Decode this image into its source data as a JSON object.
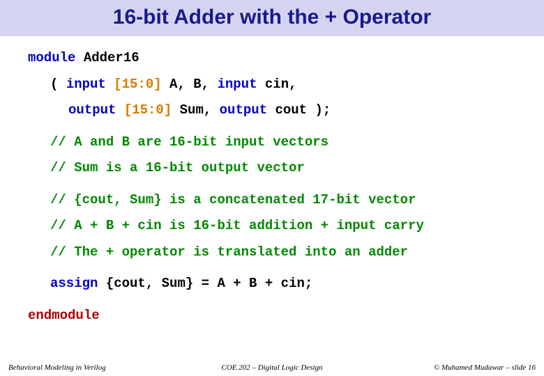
{
  "title": "16-bit Adder with the + Operator",
  "code": {
    "l1_module": "module",
    "l1_name": " Adder16",
    "l2_paren": "( ",
    "l2_input1": "input",
    "l2_range1": " [15:0] ",
    "l2_ab": "A, B, ",
    "l2_input2": "input",
    "l2_cin": " cin,",
    "l3_output1": "output",
    "l3_range2": " [15:0] ",
    "l3_sum": "Sum, ",
    "l3_output2": "output",
    "l3_cout": " cout );",
    "c1": "// A and B are 16-bit input vectors",
    "c2": "// Sum is a 16-bit output vector",
    "c3": "// {cout, Sum} is a concatenated 17-bit vector",
    "c4": "// A + B + cin is 16-bit addition + input carry",
    "c5": "// The + operator is translated into an adder",
    "assign_kw": "assign",
    "assign_expr": " {cout, Sum} = A + B + cin;",
    "endmodule": "endmodule"
  },
  "footer": {
    "left": "Behavioral Modeling in Verilog",
    "center": "COE 202 – Digital Logic Design",
    "right": "© Muhamed Mudawar – slide 16"
  }
}
